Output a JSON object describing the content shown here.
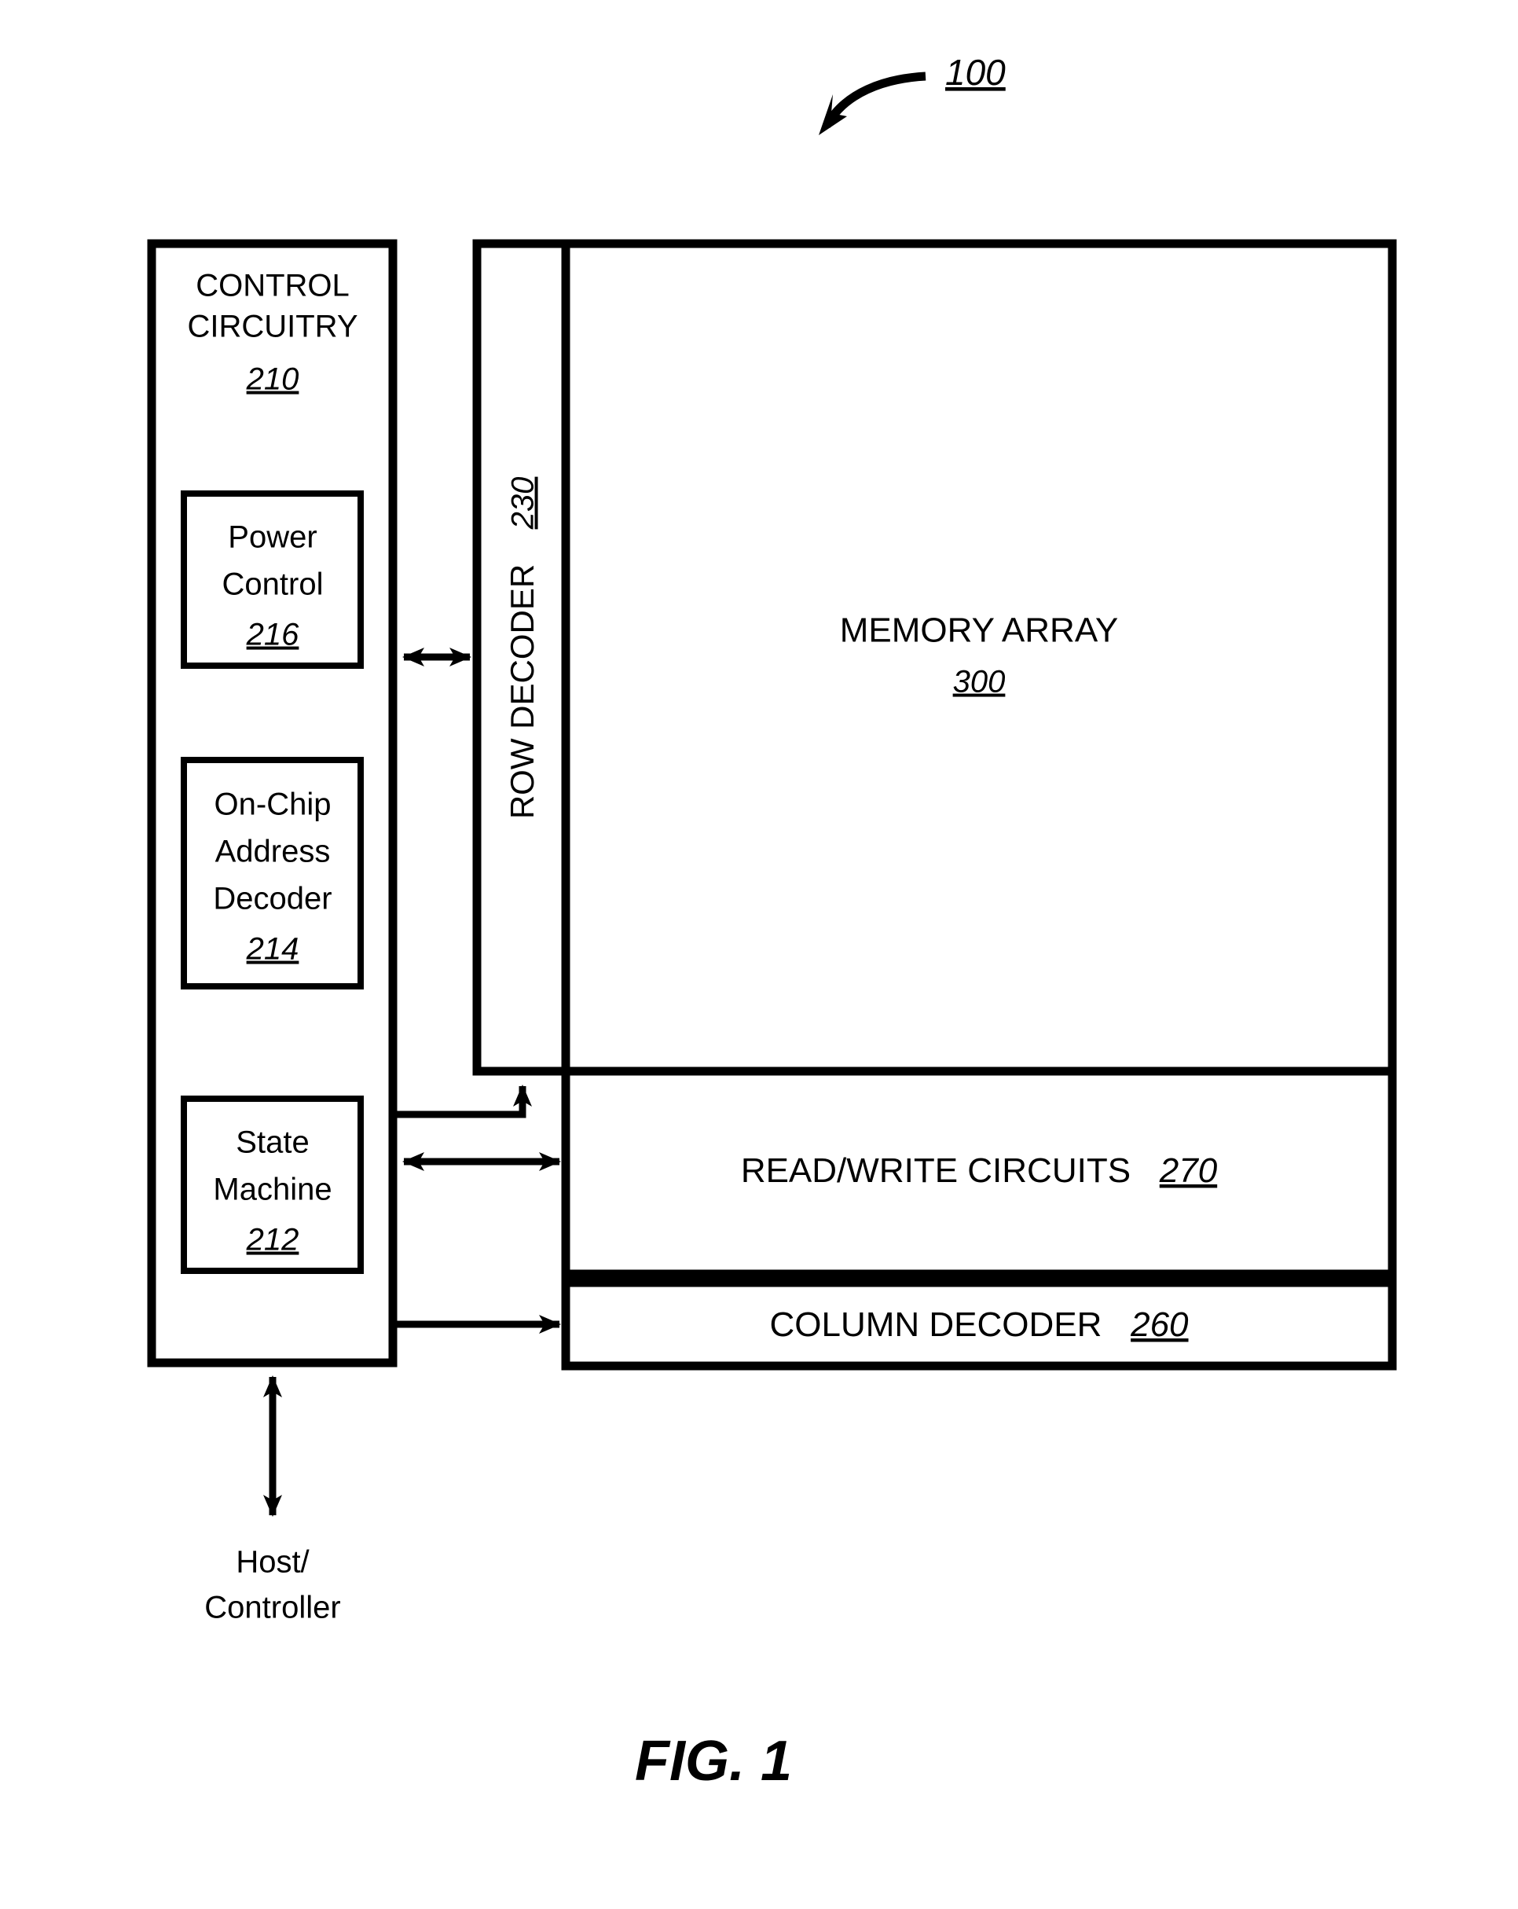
{
  "figure": {
    "reference_number": "100",
    "caption": "FIG. 1"
  },
  "control_circuitry": {
    "title_line1": "CONTROL",
    "title_line2": "CIRCUITRY",
    "number": "210",
    "modules": [
      {
        "id": "power-control",
        "lines": [
          "Power",
          "Control"
        ],
        "number": "216"
      },
      {
        "id": "on-chip-address-decoder",
        "lines": [
          "On-Chip",
          "Address",
          "Decoder"
        ],
        "number": "214"
      },
      {
        "id": "state-machine",
        "lines": [
          "State",
          "Machine"
        ],
        "number": "212"
      }
    ]
  },
  "row_decoder": {
    "label": "ROW DECODER",
    "number": "230"
  },
  "memory_array": {
    "label": "MEMORY ARRAY",
    "number": "300"
  },
  "read_write_circuits": {
    "label": "READ/WRITE CIRCUITS",
    "number": "270"
  },
  "column_decoder": {
    "label": "COLUMN DECODER",
    "number": "260"
  },
  "host": {
    "line1": "Host/",
    "line2": "Controller"
  },
  "colors": {
    "stroke": "#000000",
    "background": "#ffffff",
    "text": "#000000"
  }
}
